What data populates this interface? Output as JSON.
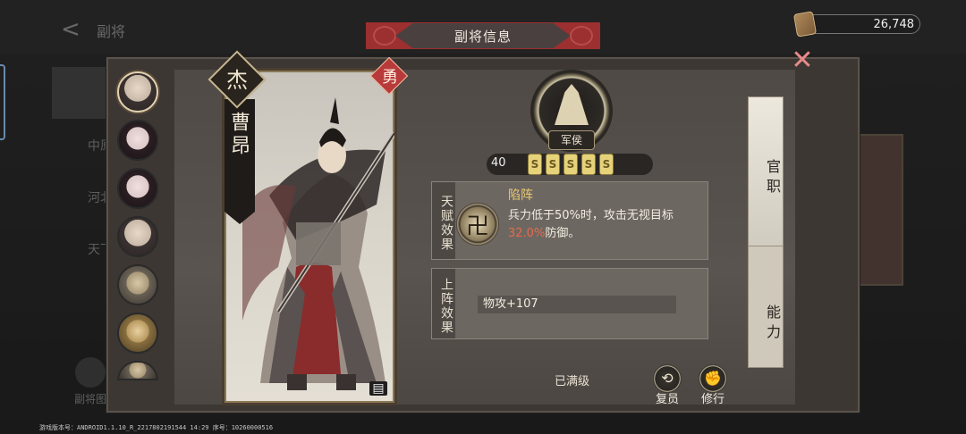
{
  "background": {
    "back_label": "副将",
    "left_list": [
      "",
      "中原",
      "河北",
      "天下"
    ],
    "bottom_button": "副将图",
    "version_text": "游戏版本号：ANDROID1.1.10_R_2217802191544 14:29 序号：10260000516"
  },
  "currency": {
    "value": "26,748",
    "icon": "jade-token-icon"
  },
  "title": "副将信息",
  "card": {
    "name": "曹昂",
    "rarity_badge": "杰",
    "type_badge": "勇",
    "book_icon": "book-icon"
  },
  "rank": {
    "label": "军侯",
    "level": "40",
    "scroll_glyph": "S",
    "stars": 5
  },
  "talent": {
    "side_label": "天赋效果",
    "name": "陷阵",
    "icon_glyph": "卍",
    "desc_pre": "兵力低于50%时，攻击无视目标",
    "desc_pct": "32.0%",
    "desc_post": "防御。"
  },
  "deploy": {
    "side_label": "上阵效果",
    "stat": "物攻+107"
  },
  "max_level": "已满级",
  "actions": [
    {
      "label": "复员",
      "icon": "recycle-icon"
    },
    {
      "label": "修行",
      "icon": "fist-icon"
    }
  ],
  "tabs": [
    "官职",
    "能力"
  ],
  "avatars": [
    "male-general",
    "female",
    "female-2",
    "male-bearded",
    "armored",
    "gold-armored",
    "partial"
  ]
}
